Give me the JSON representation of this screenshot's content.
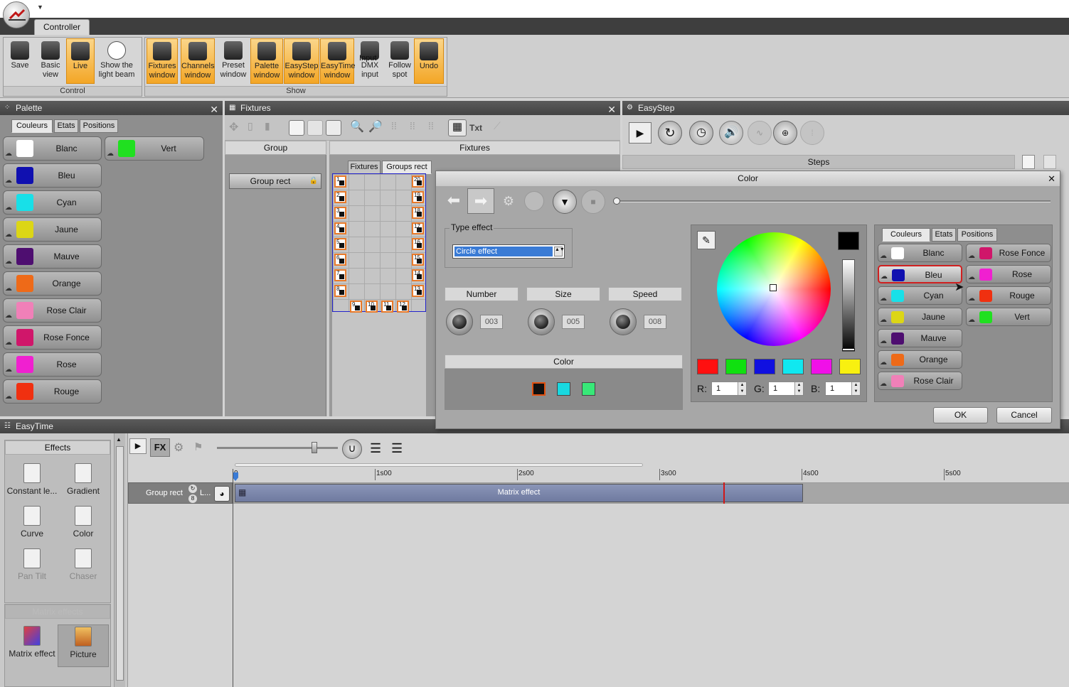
{
  "ribbon": {
    "tab": "Controller",
    "groups": {
      "control": "Control",
      "show": "Show"
    },
    "buttons": [
      {
        "id": "save",
        "l1": "Save",
        "l2": "",
        "on": false
      },
      {
        "id": "basic",
        "l1": "Basic",
        "l2": "view",
        "on": false
      },
      {
        "id": "live",
        "l1": "Live",
        "l2": "",
        "on": true
      },
      {
        "id": "beam",
        "l1": "Show the",
        "l2": "light beam",
        "on": false
      },
      {
        "id": "fixtures",
        "l1": "Fixtures",
        "l2": "window",
        "on": true
      },
      {
        "id": "channels",
        "l1": "Channels",
        "l2": "window",
        "on": true
      },
      {
        "id": "preset",
        "l1": "Preset",
        "l2": "window",
        "on": false
      },
      {
        "id": "palette",
        "l1": "Palette",
        "l2": "window",
        "on": true
      },
      {
        "id": "easystep",
        "l1": "EasyStep",
        "l2": "window",
        "on": true
      },
      {
        "id": "easytime",
        "l1": "EasyTime",
        "l2": "window",
        "on": true
      },
      {
        "id": "dmx",
        "l1": "DMX",
        "l2": "input",
        "on": false
      },
      {
        "id": "follow",
        "l1": "Follow",
        "l2": "spot",
        "on": false
      },
      {
        "id": "undo",
        "l1": "Undo",
        "l2": "",
        "on": true
      }
    ],
    "input_overlay": "Input"
  },
  "palette": {
    "title": "Palette",
    "tabs": [
      "Couleurs",
      "Etats",
      "Positions"
    ],
    "colors": [
      {
        "name": "Blanc",
        "hex": "#ffffff"
      },
      {
        "name": "Bleu",
        "hex": "#1010b0"
      },
      {
        "name": "Cyan",
        "hex": "#18e0e8"
      },
      {
        "name": "Jaune",
        "hex": "#dcd616"
      },
      {
        "name": "Mauve",
        "hex": "#4e0e70"
      },
      {
        "name": "Orange",
        "hex": "#ee6a18"
      },
      {
        "name": "Rose Clair",
        "hex": "#f080b8"
      },
      {
        "name": "Rose Fonce",
        "hex": "#d0166a"
      },
      {
        "name": "Rose",
        "hex": "#f020d0"
      },
      {
        "name": "Rouge",
        "hex": "#f03010"
      }
    ],
    "extra": {
      "name": "Vert",
      "hex": "#20e020"
    }
  },
  "fixtures": {
    "title": "Fixtures",
    "group_header": "Group",
    "fixtures_header": "Fixtures",
    "group_item": "Group rect",
    "tabs": [
      "Fixtures",
      "Groups rect"
    ],
    "txt_button": "Txt",
    "left_cells": [
      "1",
      "2",
      "3",
      "4",
      "5",
      "6",
      "7",
      "8"
    ],
    "right_cells": [
      "20",
      "19",
      "18",
      "17",
      "16",
      "15",
      "14",
      "13"
    ],
    "bottom_cells": [
      "9",
      "10",
      "11",
      "12"
    ]
  },
  "easystep": {
    "title": "EasyStep",
    "steps_header": "Steps"
  },
  "color_dialog": {
    "title": "Color",
    "type_effect_label": "Type effect",
    "type_effect_value": "Circle effect",
    "number_label": "Number",
    "number_value": "003",
    "size_label": "Size",
    "size_value": "005",
    "speed_label": "Speed",
    "speed_value": "008",
    "color_section_label": "Color",
    "chips": [
      "#101010",
      "#18d8e0",
      "#38e878"
    ],
    "preset_chips": [
      "#ff1010",
      "#10e010",
      "#1010e0",
      "#10e8f0",
      "#f010e8",
      "#f8f010"
    ],
    "r_label": "R:",
    "r_value": "1",
    "g_label": "G:",
    "g_value": "1",
    "b_label": "B:",
    "b_value": "1",
    "tabs": [
      "Couleurs",
      "Etats",
      "Positions"
    ],
    "colors_left": [
      {
        "name": "Blanc",
        "hex": "#ffffff"
      },
      {
        "name": "Bleu",
        "hex": "#1010b0"
      },
      {
        "name": "Cyan",
        "hex": "#18e0e8"
      },
      {
        "name": "Jaune",
        "hex": "#dcd616"
      },
      {
        "name": "Mauve",
        "hex": "#4e0e70"
      },
      {
        "name": "Orange",
        "hex": "#ee6a18"
      },
      {
        "name": "Rose Clair",
        "hex": "#f080b8"
      }
    ],
    "colors_right": [
      {
        "name": "Rose Fonce",
        "hex": "#d0166a"
      },
      {
        "name": "Rose",
        "hex": "#f020d0"
      },
      {
        "name": "Rouge",
        "hex": "#f03010"
      },
      {
        "name": "Vert",
        "hex": "#20e020"
      }
    ],
    "ok": "OK",
    "cancel": "Cancel"
  },
  "easytime": {
    "title": "EasyTime",
    "effects_header": "Effects",
    "effects": [
      {
        "name": "Constant le...",
        "dim": false
      },
      {
        "name": "Gradient",
        "dim": false
      },
      {
        "name": "Curve",
        "dim": false
      },
      {
        "name": "Color",
        "dim": false
      },
      {
        "name": "Pan Tilt",
        "dim": true
      },
      {
        "name": "Chaser",
        "dim": true
      }
    ],
    "matrix_header": "Matrix effects",
    "matrix_effects": [
      {
        "name": "Matrix effect"
      },
      {
        "name": "Picture"
      }
    ],
    "ticks": [
      "0",
      "1s00",
      "2s00",
      "3s00",
      "4s00",
      "5s00"
    ],
    "track_label": "Group rect",
    "track_short": "L...",
    "clip_label": "Matrix effect"
  }
}
